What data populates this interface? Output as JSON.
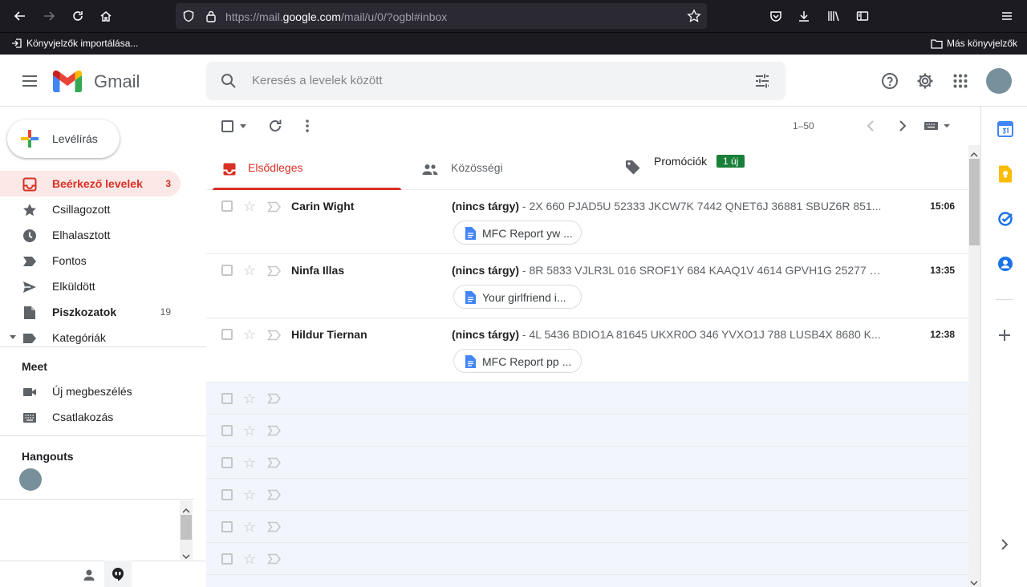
{
  "browser": {
    "url_prefix": "https://mail.",
    "url_domain": "google.com",
    "url_suffix": "/mail/u/0/?ogbl#inbox",
    "bookmark_import": "Könyvjelzők importálása...",
    "bookmark_other": "Más könyvjelzők"
  },
  "header": {
    "app_name": "Gmail",
    "search_placeholder": "Keresés a levelek között"
  },
  "sidebar": {
    "compose_label": "Levélírás",
    "items": [
      {
        "label": "Beérkező levelek",
        "count": "3",
        "icon": "inbox-icon"
      },
      {
        "label": "Csillagozott",
        "count": "",
        "icon": "star-icon"
      },
      {
        "label": "Elhalasztott",
        "count": "",
        "icon": "clock-icon"
      },
      {
        "label": "Fontos",
        "count": "",
        "icon": "important-icon"
      },
      {
        "label": "Elküldött",
        "count": "",
        "icon": "send-icon"
      },
      {
        "label": "Piszkozatok",
        "count": "19",
        "icon": "draft-icon"
      },
      {
        "label": "Kategóriák",
        "count": "",
        "icon": "label-icon"
      }
    ],
    "meet_title": "Meet",
    "meet_items": [
      {
        "label": "Új megbeszélés",
        "icon": "video-icon"
      },
      {
        "label": "Csatlakozás",
        "icon": "keyboard-icon"
      }
    ],
    "hangouts_title": "Hangouts"
  },
  "toolbar": {
    "page_range": "1–50"
  },
  "tabs": [
    {
      "label": "Elsődleges",
      "icon": "inbox-icon"
    },
    {
      "label": "Közösségi",
      "icon": "people-icon"
    },
    {
      "label": "Promóciók",
      "icon": "tag-icon",
      "badge": "1 új"
    }
  ],
  "emails": [
    {
      "sender": "Carin Wight",
      "subject": "(nincs tárgy)",
      "snippet": " - 2X 660 PJAD5U 52333 JKCW7K 7442 QNET6J 36881 SBUZ6R 851...",
      "time": "15:06",
      "attachment": "MFC Report yw ..."
    },
    {
      "sender": "Ninfa Illas",
      "subject": "(nincs tárgy)",
      "snippet": " - 8R 5833 VJLR3L 016 SROF1Y 684 KAAQ1V 4614 GPVH1G 25277 N...",
      "time": "13:35",
      "attachment": "Your girlfriend i..."
    },
    {
      "sender": "Hildur Tiernan",
      "subject": "(nincs tárgy)",
      "snippet": " - 4L 5436 BDIO1A 81645 UKXR0O 346 YVXO1J 788 LUSB4X 8680 K...",
      "time": "12:38",
      "attachment": "MFC Report pp ..."
    }
  ],
  "colors": {
    "accent_red": "#d93025",
    "badge_green": "#188038",
    "browser_dark": "#1c1b22"
  }
}
